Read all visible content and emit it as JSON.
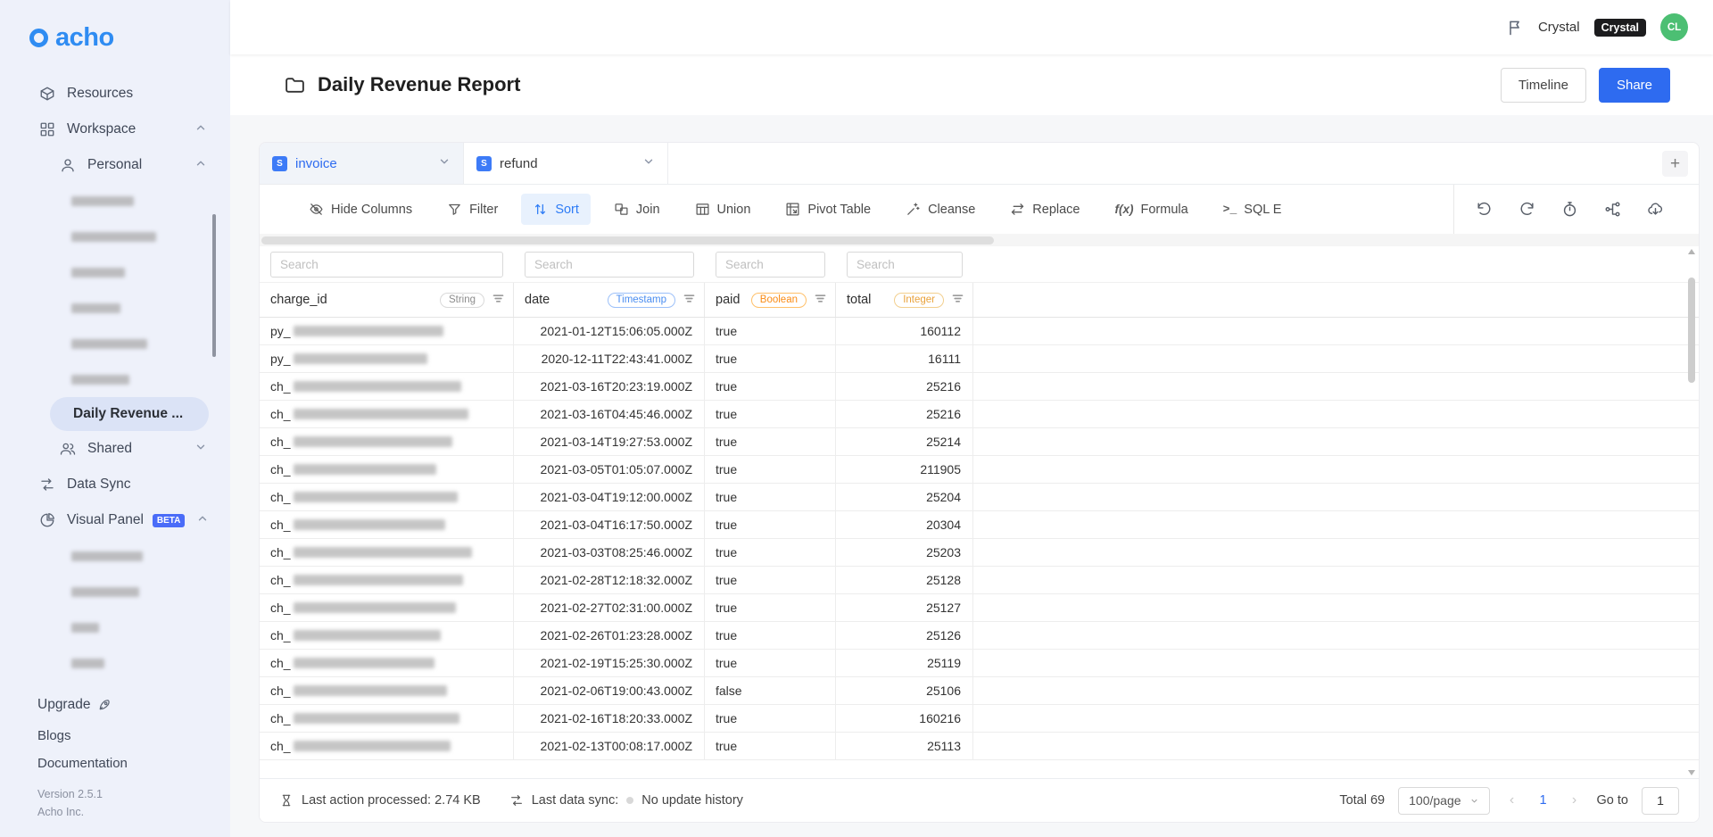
{
  "sidebar": {
    "logo": "acho",
    "items": {
      "resources": "Resources",
      "workspace": "Workspace",
      "personal": "Personal",
      "daily_revenue": "Daily Revenue ...",
      "shared": "Shared",
      "data_sync": "Data Sync",
      "visual_panel": "Visual Panel",
      "visual_panel_badge": "BETA",
      "upgrade": "Upgrade",
      "blogs": "Blogs",
      "documentation": "Documentation"
    },
    "redacted_counts": {
      "personal_sub_items": 6,
      "visual_panel_sub_items": 4
    },
    "version": "Version 2.5.1",
    "company": "Acho Inc."
  },
  "topbar": {
    "user_name": "Crystal",
    "org_badge": "Crystal",
    "avatar_initials": "CL"
  },
  "page": {
    "title": "Daily Revenue Report",
    "timeline_button": "Timeline",
    "share_button": "Share"
  },
  "tabs": {
    "invoice": "invoice",
    "refund": "refund",
    "add": "+"
  },
  "toolbar": {
    "hide_columns": "Hide Columns",
    "filter": "Filter",
    "sort": "Sort",
    "join": "Join",
    "union": "Union",
    "pivot_table": "Pivot Table",
    "cleanse": "Cleanse",
    "replace": "Replace",
    "formula": "Formula",
    "formula_icon_text": "f(x)",
    "sql_icon_text": ">_",
    "sql_editor": "SQL E"
  },
  "table": {
    "search_placeholder": "Search",
    "columns": [
      {
        "name": "charge_id",
        "type": "String"
      },
      {
        "name": "date",
        "type": "Timestamp"
      },
      {
        "name": "paid",
        "type": "Boolean"
      },
      {
        "name": "total",
        "type": "Integer"
      }
    ],
    "rows": [
      {
        "prefix": "py_",
        "blur": 168,
        "date": "2021-01-12T15:06:05.000Z",
        "paid": "true",
        "total": "160112"
      },
      {
        "prefix": "py_",
        "blur": 150,
        "date": "2020-12-11T22:43:41.000Z",
        "paid": "true",
        "total": "16111"
      },
      {
        "prefix": "ch_",
        "blur": 188,
        "date": "2021-03-16T20:23:19.000Z",
        "paid": "true",
        "total": "25216"
      },
      {
        "prefix": "ch_",
        "blur": 196,
        "date": "2021-03-16T04:45:46.000Z",
        "paid": "true",
        "total": "25216"
      },
      {
        "prefix": "ch_",
        "blur": 178,
        "date": "2021-03-14T19:27:53.000Z",
        "paid": "true",
        "total": "25214"
      },
      {
        "prefix": "ch_",
        "blur": 160,
        "date": "2021-03-05T01:05:07.000Z",
        "paid": "true",
        "total": "211905"
      },
      {
        "prefix": "ch_",
        "blur": 184,
        "date": "2021-03-04T19:12:00.000Z",
        "paid": "true",
        "total": "25204"
      },
      {
        "prefix": "ch_",
        "blur": 170,
        "date": "2021-03-04T16:17:50.000Z",
        "paid": "true",
        "total": "20304"
      },
      {
        "prefix": "ch_",
        "blur": 200,
        "date": "2021-03-03T08:25:46.000Z",
        "paid": "true",
        "total": "25203"
      },
      {
        "prefix": "ch_",
        "blur": 190,
        "date": "2021-02-28T12:18:32.000Z",
        "paid": "true",
        "total": "25128"
      },
      {
        "prefix": "ch_",
        "blur": 182,
        "date": "2021-02-27T02:31:00.000Z",
        "paid": "true",
        "total": "25127"
      },
      {
        "prefix": "ch_",
        "blur": 165,
        "date": "2021-02-26T01:23:28.000Z",
        "paid": "true",
        "total": "25126"
      },
      {
        "prefix": "ch_",
        "blur": 158,
        "date": "2021-02-19T15:25:30.000Z",
        "paid": "true",
        "total": "25119"
      },
      {
        "prefix": "ch_",
        "blur": 172,
        "date": "2021-02-06T19:00:43.000Z",
        "paid": "false",
        "total": "25106"
      },
      {
        "prefix": "ch_",
        "blur": 186,
        "date": "2021-02-16T18:20:33.000Z",
        "paid": "true",
        "total": "160216"
      },
      {
        "prefix": "ch_",
        "blur": 176,
        "date": "2021-02-13T00:08:17.000Z",
        "paid": "true",
        "total": "25113"
      }
    ]
  },
  "statusbar": {
    "last_action": "Last action processed: 2.74 KB",
    "last_sync_label": "Last data sync:",
    "last_sync_value": "No update history",
    "total": "Total 69",
    "page_size": "100/page",
    "prev": "‹",
    "next": "›",
    "current_page": "1",
    "goto_label": "Go to",
    "goto_value": "1"
  }
}
